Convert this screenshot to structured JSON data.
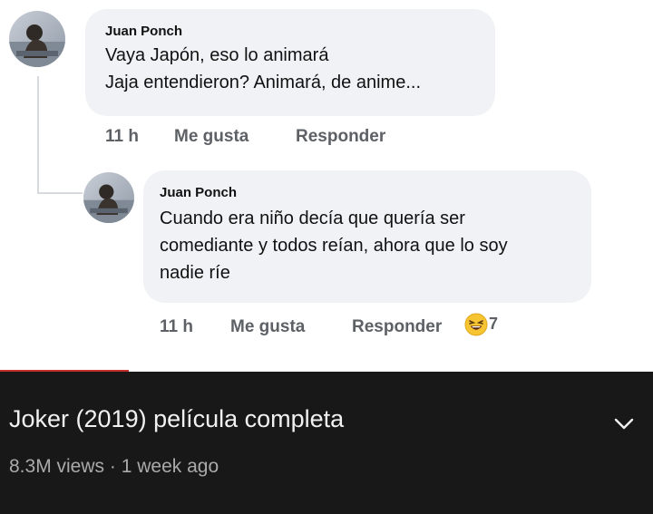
{
  "comments": [
    {
      "author": "Juan Ponch",
      "lines": [
        "Vaya Japón, eso lo animará",
        "Jaja entendieron? Animará, de anime..."
      ],
      "time": "11 h",
      "like_label": "Me gusta",
      "reply_label": "Responder"
    },
    {
      "author": "Juan Ponch",
      "lines": [
        "Cuando era niño decía que quería ser",
        "comediante y todos reían, ahora que lo soy",
        "nadie ríe"
      ],
      "time": "11 h",
      "like_label": "Me gusta",
      "reply_label": "Responder",
      "reaction_icon": "laughing-face-emoji",
      "reaction_count": "7"
    }
  ],
  "video": {
    "title": "Joker (2019) película completa",
    "views": "8.3M views",
    "separator": "·",
    "age": "1 week ago",
    "expand_icon": "chevron-down-icon"
  },
  "colors": {
    "bubble": "#f0f2f5",
    "meta_text": "#5d6166",
    "yt_background": "#181818",
    "yt_progress": "#c4302b"
  }
}
